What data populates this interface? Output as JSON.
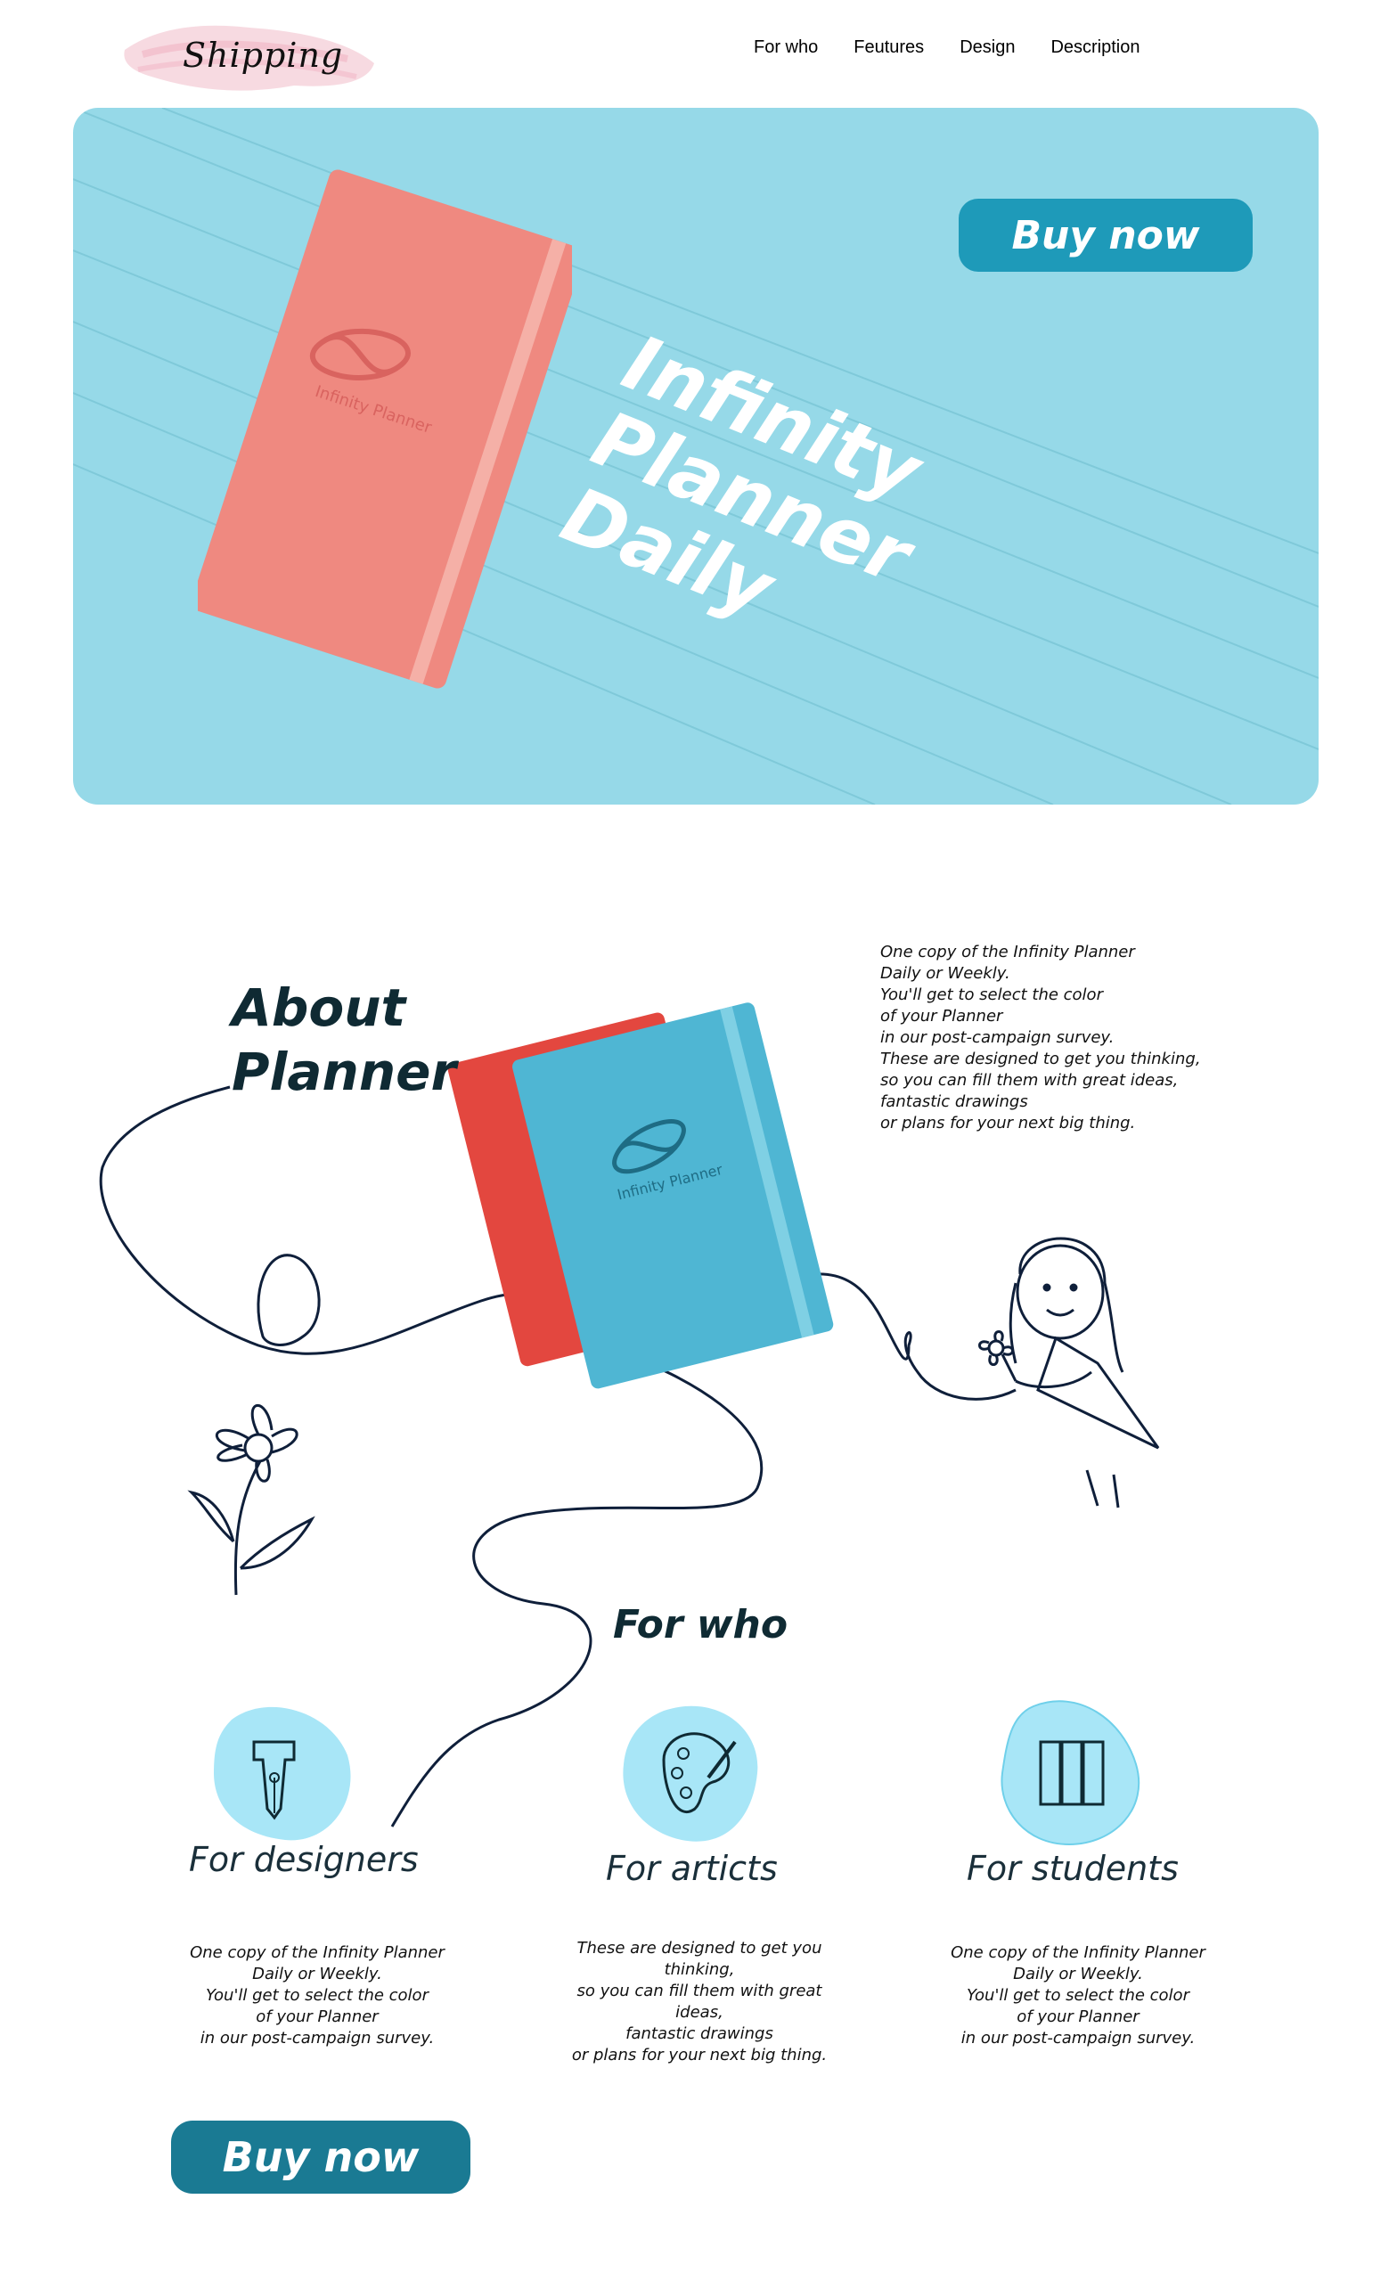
{
  "header": {
    "logo_text": "Shipping",
    "nav": [
      "For who",
      "Feutures",
      "Design",
      "Description"
    ]
  },
  "hero": {
    "buy_label": "Buy now",
    "title_lines": [
      "Infinity",
      "Planner",
      "Daily"
    ],
    "book_brand": "Infinity Planner",
    "background_color": "#96d9e8",
    "book_color": "#ee8079"
  },
  "about": {
    "title_lines": [
      "About",
      "Planner"
    ],
    "description": "One copy of the Infinity Planner\nDaily or Weekly.\nYou'll get to select the color\nof your Planner\nin our post-campaign survey.\nThese are designed to get you thinking,\nso you can fill them with great ideas,\nfantastic drawings\nor plans for your next big thing.",
    "book_brand": "Infinity Planner"
  },
  "for_who": {
    "title": "For who",
    "cards": [
      {
        "title": "For designers",
        "icon": "pen-nib-icon",
        "text": "One copy of the Infinity Planner\nDaily or Weekly.\nYou'll get to select the color\nof your Planner\nin our post-campaign survey."
      },
      {
        "title": "For articts",
        "icon": "palette-icon",
        "text": "These are designed to get you\nthinking,\nso you can fill them with great\nideas,\nfantastic drawings\nor plans for your next big thing."
      },
      {
        "title": "For students",
        "icon": "books-icon",
        "text": "One copy of the Infinity Planner\nDaily or Weekly.\nYou'll get to select the color\nof your Planner\nin our post-campaign survey."
      }
    ]
  },
  "footer": {
    "buy_label": "Buy now"
  }
}
